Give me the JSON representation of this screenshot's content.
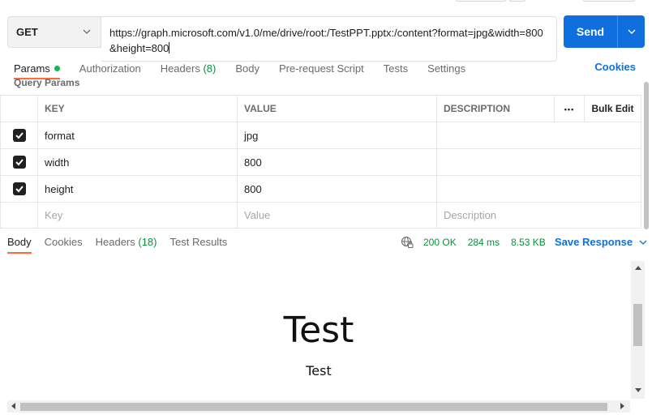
{
  "request": {
    "method": "GET",
    "url": "https://graph.microsoft.com/v1.0/me/drive/root:/TestPPT.pptx:/content?format=jpg&width=800&height=800",
    "send_label": "Send"
  },
  "request_tabs": [
    {
      "label": "Params",
      "active": true
    },
    {
      "label": "Authorization"
    },
    {
      "label": "Headers",
      "count": "(8)"
    },
    {
      "label": "Body"
    },
    {
      "label": "Pre-request Script"
    },
    {
      "label": "Tests"
    },
    {
      "label": "Settings"
    }
  ],
  "cookies_link": "Cookies",
  "query_params": {
    "label": "Query Params",
    "headers": {
      "key": "KEY",
      "value": "VALUE",
      "description": "DESCRIPTION",
      "more": "•••",
      "bulk_edit": "Bulk Edit"
    },
    "rows": [
      {
        "key": "format",
        "value": "jpg",
        "description": "",
        "checked": true
      },
      {
        "key": "width",
        "value": "800",
        "description": "",
        "checked": true
      },
      {
        "key": "height",
        "value": "800",
        "description": "",
        "checked": true
      }
    ],
    "placeholders": {
      "key": "Key",
      "value": "Value",
      "description": "Description"
    }
  },
  "response_tabs": [
    {
      "label": "Body",
      "active": true
    },
    {
      "label": "Cookies"
    },
    {
      "label": "Headers",
      "count": "(18)"
    },
    {
      "label": "Test Results"
    }
  ],
  "response_meta": {
    "status": "200 OK",
    "time": "284 ms",
    "size": "8.53 KB",
    "save_label": "Save Response"
  },
  "preview": {
    "title": "Test",
    "subtitle": "Test"
  },
  "colors": {
    "accent": "#0f6fde",
    "active_tab": "#ff6c37",
    "success": "#0a8f3c"
  }
}
